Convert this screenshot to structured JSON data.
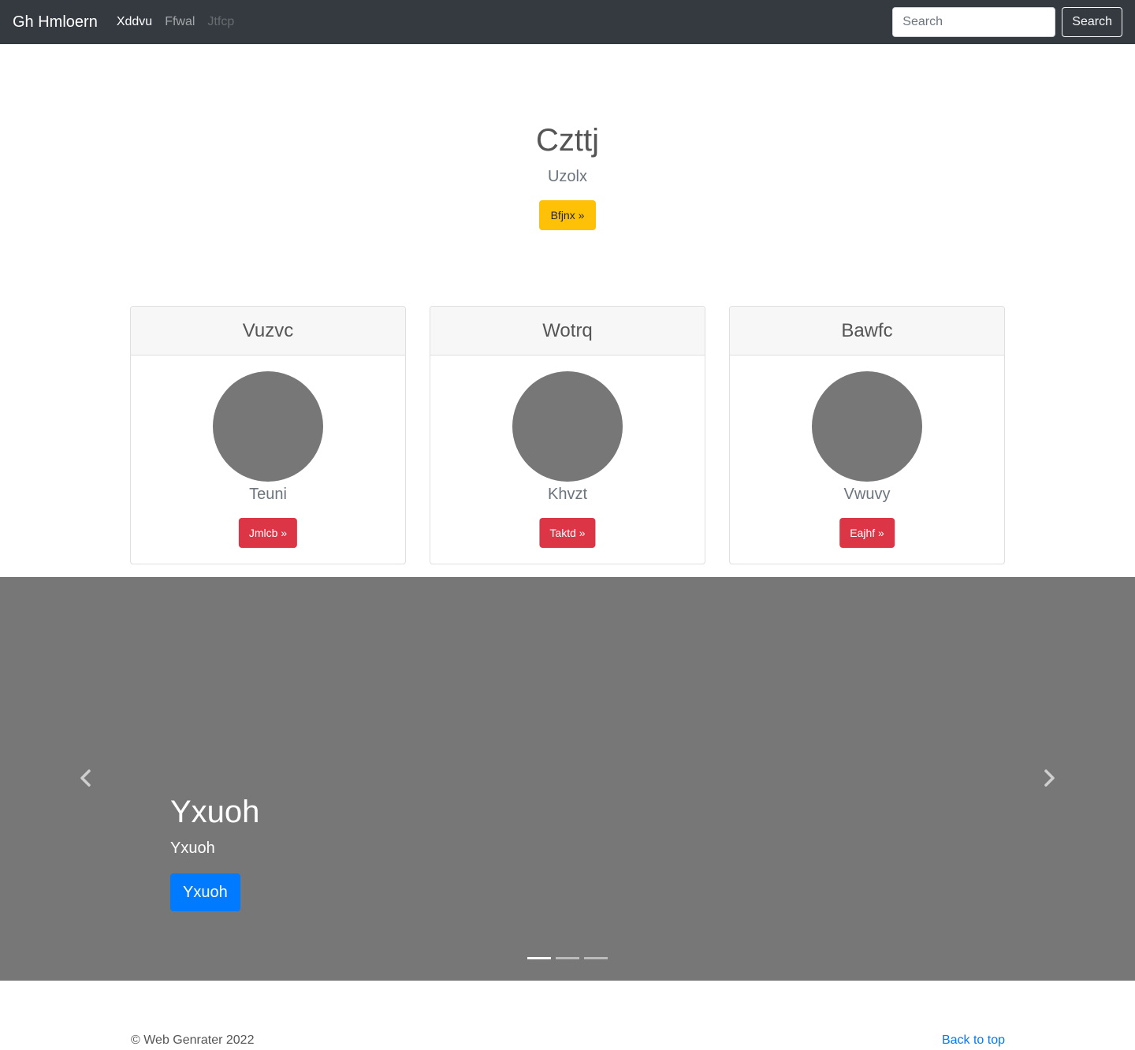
{
  "navbar": {
    "brand": "Gh Hmloern",
    "links": [
      {
        "label": "Xddvu",
        "state": "active"
      },
      {
        "label": "Ffwal",
        "state": "normal"
      },
      {
        "label": "Jtfcp",
        "state": "disabled"
      }
    ],
    "search_placeholder": "Search",
    "search_button": "Search"
  },
  "hero": {
    "title": "Czttj",
    "subtitle": "Uzolx",
    "button": "Bfjnx »"
  },
  "cards": [
    {
      "title": "Vuzvc",
      "text": "Teuni",
      "button": "Jmlcb »"
    },
    {
      "title": "Wotrq",
      "text": "Khvzt",
      "button": "Taktd »"
    },
    {
      "title": "Bawfc",
      "text": "Vwuvy",
      "button": "Eajhf »"
    }
  ],
  "carousel": {
    "title": "Yxuoh",
    "subtitle": "Yxuoh",
    "button": "Yxuoh",
    "slide_count": 3,
    "active_slide": 1
  },
  "footer": {
    "copyright": "© Web Genrater 2022",
    "back_to_top": "Back to top"
  },
  "colors": {
    "navbar_bg": "#343a40",
    "hero_button": "#ffc107",
    "card_button": "#dc3545",
    "carousel_bg": "#777777",
    "primary": "#007bff"
  }
}
